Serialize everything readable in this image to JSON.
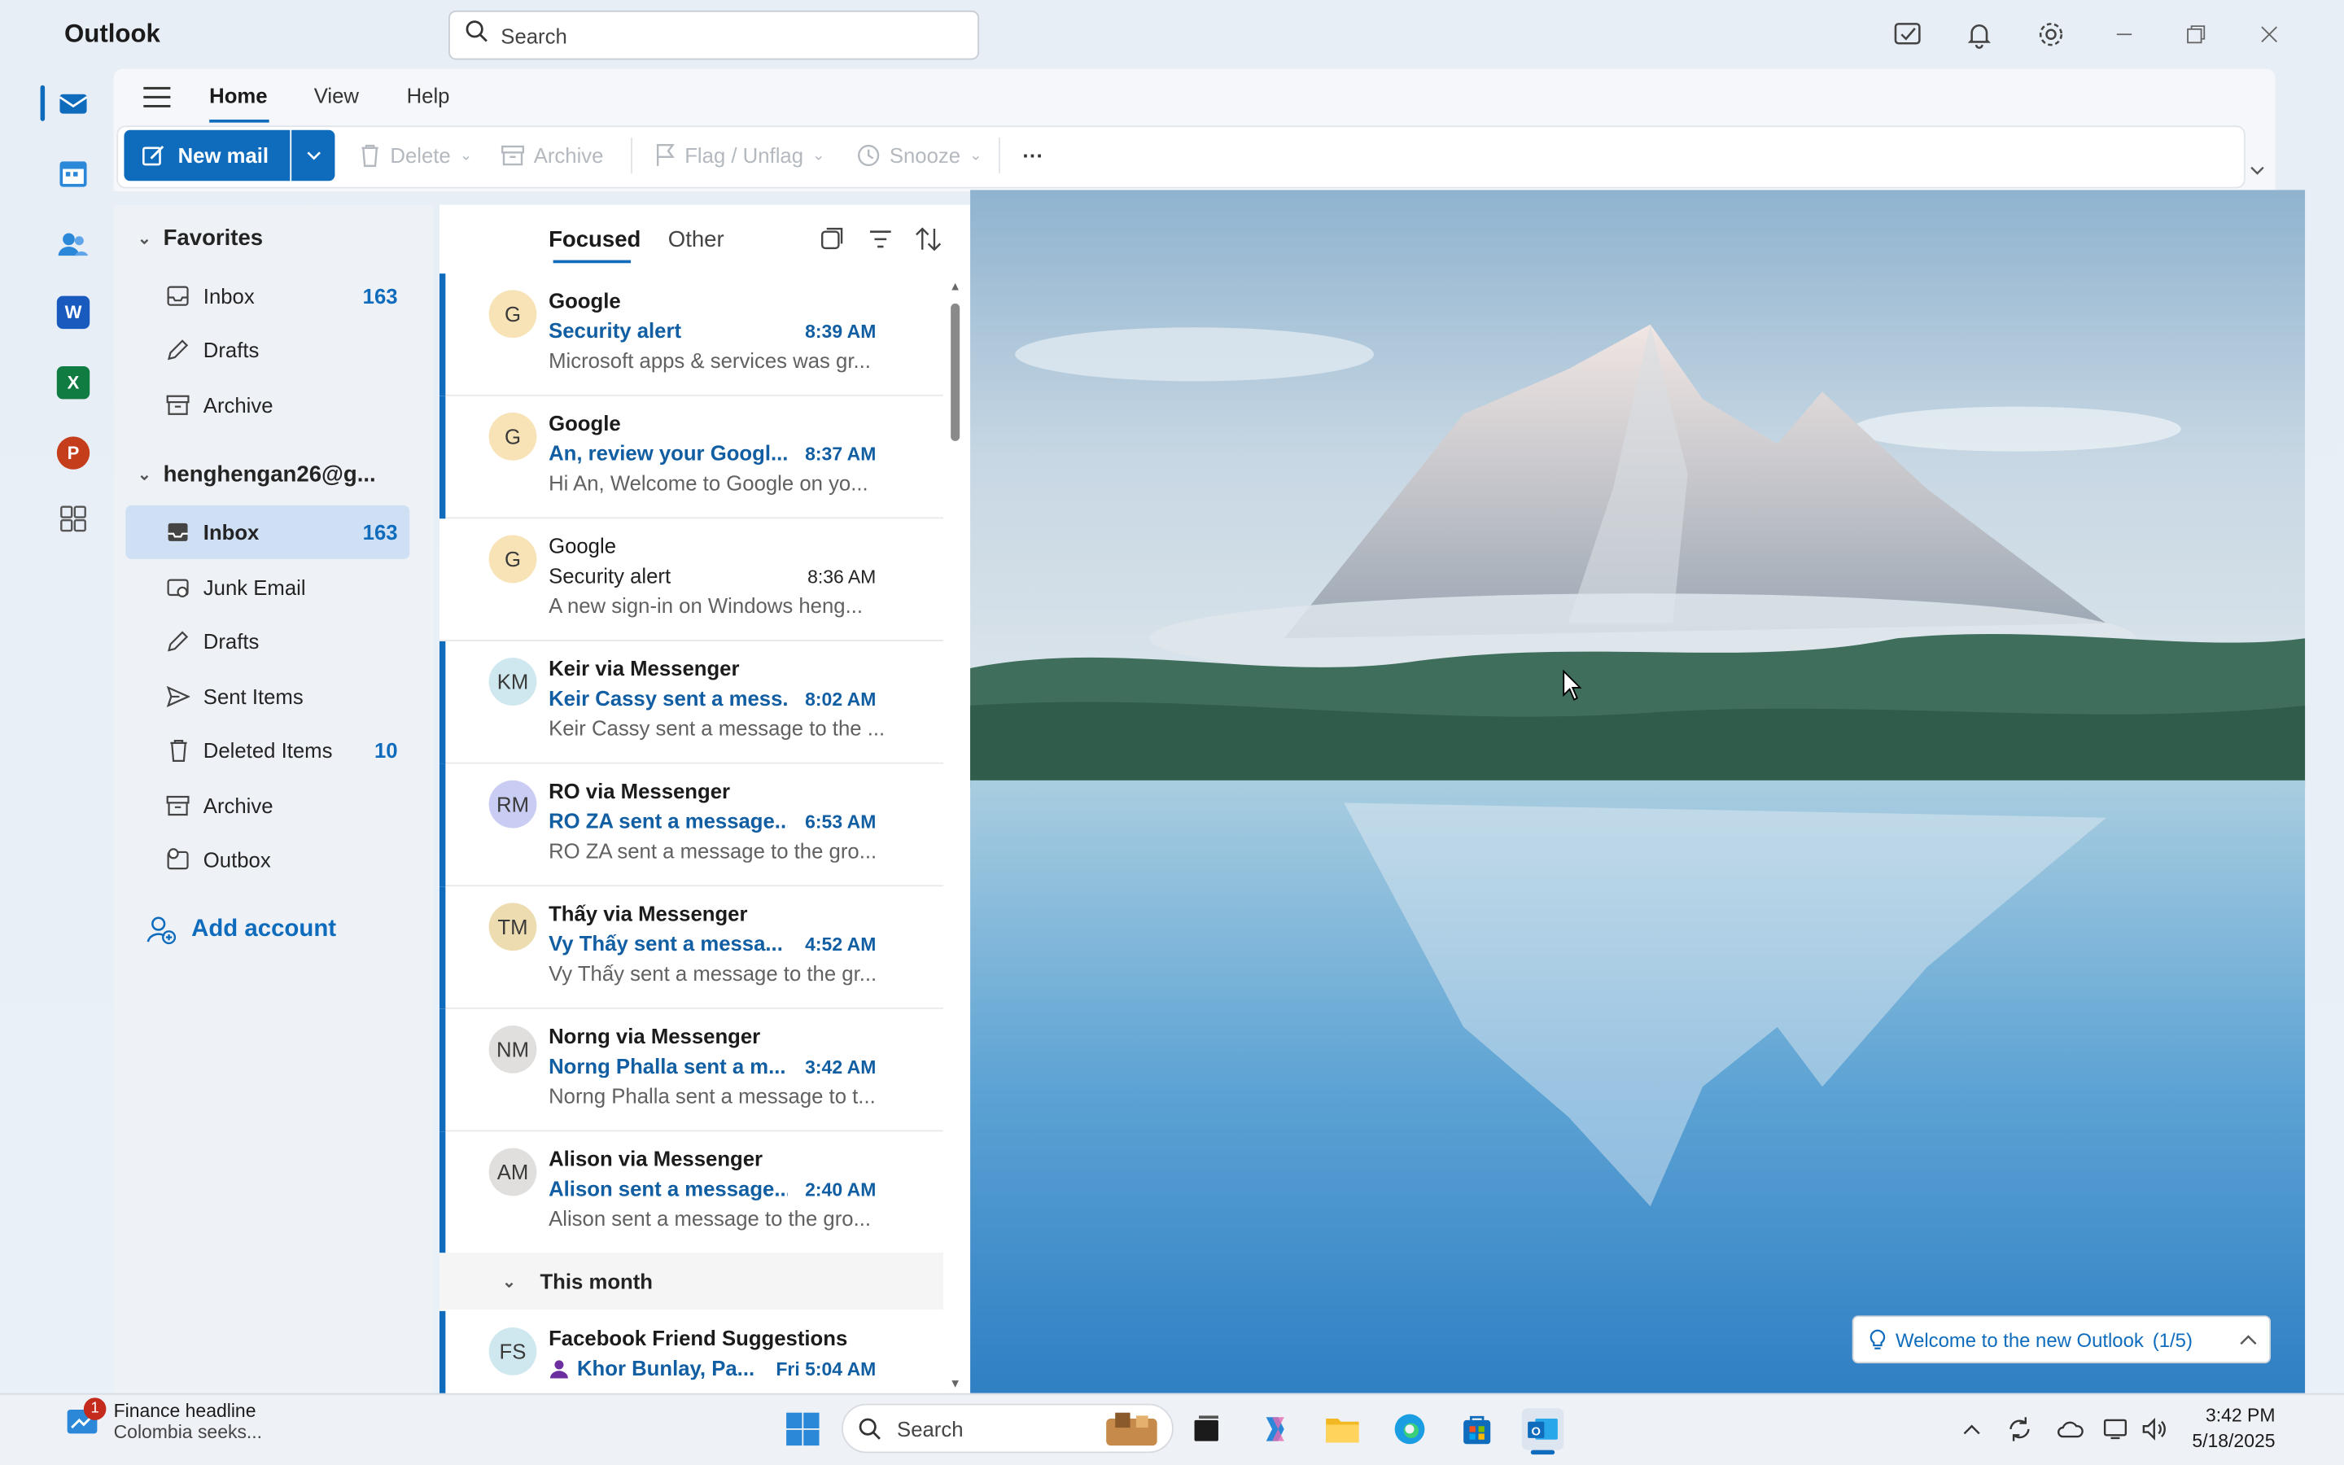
{
  "window": {
    "app_title": "Outlook",
    "search_placeholder": "Search"
  },
  "ribbon": {
    "tabs": [
      "Home",
      "View",
      "Help"
    ],
    "new_mail": "New mail",
    "delete": "Delete",
    "archive": "Archive",
    "flag": "Flag / Unflag",
    "snooze": "Snooze",
    "more": "···"
  },
  "folders": {
    "favorites_title": "Favorites",
    "favorites": [
      {
        "label": "Inbox",
        "count": "163"
      },
      {
        "label": "Drafts",
        "count": ""
      },
      {
        "label": "Archive",
        "count": ""
      }
    ],
    "account_title": "henghengan26@g...",
    "account": [
      {
        "label": "Inbox",
        "count": "163"
      },
      {
        "label": "Junk Email",
        "count": ""
      },
      {
        "label": "Drafts",
        "count": ""
      },
      {
        "label": "Sent Items",
        "count": ""
      },
      {
        "label": "Deleted Items",
        "count": "10"
      },
      {
        "label": "Archive",
        "count": ""
      },
      {
        "label": "Outbox",
        "count": ""
      }
    ],
    "add_account": "Add account"
  },
  "list": {
    "tab_focused": "Focused",
    "tab_other": "Other",
    "messages": [
      {
        "initials": "G",
        "sender": "Google",
        "subject": "Security alert",
        "time": "8:39 AM",
        "preview": "Microsoft apps & services was gr..."
      },
      {
        "initials": "G",
        "sender": "Google",
        "subject": "An, review your Googl...",
        "time": "8:37 AM",
        "preview": "Hi An, Welcome to Google on yo..."
      },
      {
        "initials": "G",
        "sender": "Google",
        "subject": "Security alert",
        "time": "8:36 AM",
        "preview": "A new sign-in on Windows heng..."
      },
      {
        "initials": "KM",
        "sender": "Keir via Messenger",
        "subject": "Keir Cassy sent a mess...",
        "time": "8:02 AM",
        "preview": "Keir Cassy sent a message to the ..."
      },
      {
        "initials": "RM",
        "sender": "RO via Messenger",
        "subject": "RO ZA sent a message...",
        "time": "6:53 AM",
        "preview": "RO ZA sent a message to the gro..."
      },
      {
        "initials": "TM",
        "sender": "Thấy via Messenger",
        "subject": "Vy Thấy sent a messa...",
        "time": "4:52 AM",
        "preview": "Vy Thấy sent a message to the gr..."
      },
      {
        "initials": "NM",
        "sender": "Norng via Messenger",
        "subject": "Norng Phalla sent a m...",
        "time": "3:42 AM",
        "preview": "Norng Phalla sent a message to t..."
      },
      {
        "initials": "AM",
        "sender": "Alison via Messenger",
        "subject": "Alison sent a message...",
        "time": "2:40 AM",
        "preview": "Alison sent a message to the gro..."
      }
    ],
    "group_header": "This month",
    "fs_msg": {
      "initials": "FS",
      "sender": "Facebook Friend Suggestions",
      "subject": "Khor Bunlay, Pa...",
      "time": "Fri 5:04 AM"
    }
  },
  "reading": {
    "welcome": "Welcome to the new Outlook",
    "welcome_step": "(1/5)"
  },
  "taskbar": {
    "news_badge": "1",
    "news_title": "Finance headline",
    "news_sub": "Colombia seeks...",
    "search": "Search",
    "time": "3:42 PM",
    "date": "5/18/2025"
  },
  "colors": {
    "accent": "#0f6cbd",
    "unread_text": "#115ea3",
    "selected_folder": "#cfe0f4"
  }
}
